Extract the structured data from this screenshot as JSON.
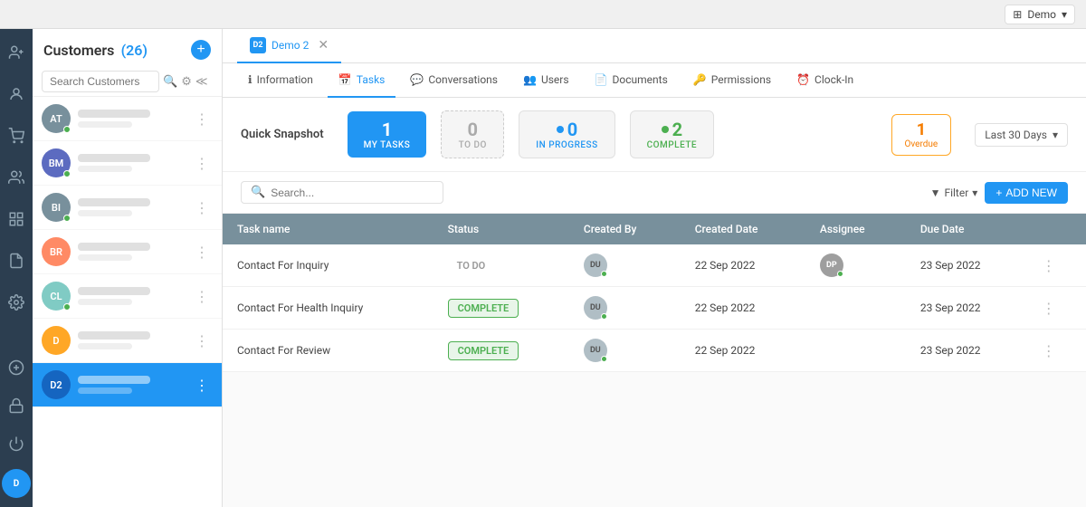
{
  "topbar": {
    "demo_label": "Demo",
    "dropdown_icon": "▾"
  },
  "leftnav": {
    "icons": [
      {
        "name": "add-user-icon",
        "symbol": "👤+",
        "unicode": "⊕"
      },
      {
        "name": "contacts-icon",
        "symbol": "☺"
      },
      {
        "name": "cart-icon",
        "symbol": "🛒"
      },
      {
        "name": "team-icon",
        "symbol": "👥"
      },
      {
        "name": "apps-icon",
        "symbol": "⊞"
      },
      {
        "name": "document-icon",
        "symbol": "📄"
      },
      {
        "name": "settings-icon",
        "symbol": "⚙"
      }
    ],
    "bottom_icons": [
      {
        "name": "add-icon",
        "symbol": "⊕"
      },
      {
        "name": "lock-icon",
        "symbol": "🔒"
      },
      {
        "name": "power-icon",
        "symbol": "⏻"
      }
    ]
  },
  "sidebar": {
    "title": "Customers",
    "count": "(26)",
    "search_placeholder": "Search Customers",
    "customers": [
      {
        "initials": "AT",
        "color": "#78909c",
        "has_dot": true
      },
      {
        "initials": "BM",
        "color": "#5c6bc0",
        "has_dot": true
      },
      {
        "initials": "BI",
        "color": "#78909c",
        "has_dot": true
      },
      {
        "initials": "BR",
        "color": "#ff8a65",
        "has_dot": false
      },
      {
        "initials": "CL",
        "color": "#80cbc4",
        "has_dot": true
      },
      {
        "initials": "D",
        "color": "#ffa726",
        "has_dot": false
      },
      {
        "initials": "D2",
        "color": "#2196f3",
        "has_dot": false,
        "active": true
      }
    ]
  },
  "tabs": [
    {
      "id": "demo2",
      "label": "Demo 2",
      "active": true,
      "closable": true,
      "avatar": "D2",
      "avatar_color": "#2196f3"
    }
  ],
  "sub_nav": {
    "items": [
      {
        "label": "Information",
        "icon": "ℹ",
        "active": false
      },
      {
        "label": "Tasks",
        "icon": "📅",
        "active": true
      },
      {
        "label": "Conversations",
        "icon": "💬",
        "active": false
      },
      {
        "label": "Users",
        "icon": "👥",
        "active": false
      },
      {
        "label": "Documents",
        "icon": "📄",
        "active": false
      },
      {
        "label": "Permissions",
        "icon": "🔑",
        "active": false
      },
      {
        "label": "Clock-In",
        "icon": "⏰",
        "active": false
      }
    ]
  },
  "quick_snapshot": {
    "label": "Quick Snapshot",
    "my_tasks": {
      "count": 1,
      "label": "My Tasks"
    },
    "todo": {
      "count": 0,
      "label": "TO DO"
    },
    "in_progress": {
      "count": 0,
      "label": "IN PROGRESS"
    },
    "complete": {
      "count": 2,
      "label": "COMPLETE"
    },
    "overdue": {
      "count": 1,
      "label": "Overdue"
    },
    "date_filter": "Last 30 Days"
  },
  "tasks": {
    "search_placeholder": "Search...",
    "filter_label": "Filter",
    "add_new_label": "ADD NEW",
    "columns": [
      "Task name",
      "Status",
      "Created By",
      "Created Date",
      "Assignee",
      "Due Date"
    ],
    "rows": [
      {
        "task_name": "Contact For Inquiry",
        "status": "TO DO",
        "status_type": "todo",
        "created_by_initials": "DU",
        "created_by_color": "#b0bec5",
        "created_date": "22 Sep 2022",
        "assignee_initials": "DP",
        "assignee_color": "#9e9e9e",
        "due_date": "23 Sep 2022",
        "assignee_has_dot": true
      },
      {
        "task_name": "Contact For Health Inquiry",
        "status": "COMPLETE",
        "status_type": "complete",
        "created_by_initials": "DU",
        "created_by_color": "#b0bec5",
        "created_date": "22 Sep 2022",
        "assignee_initials": "",
        "assignee_color": "#ccc",
        "due_date": "23 Sep 2022",
        "assignee_has_dot": false
      },
      {
        "task_name": "Contact For Review",
        "status": "COMPLETE",
        "status_type": "complete",
        "created_by_initials": "DU",
        "created_by_color": "#b0bec5",
        "created_date": "22 Sep 2022",
        "assignee_initials": "",
        "assignee_color": "#ccc",
        "due_date": "23 Sep 2022",
        "assignee_has_dot": false
      }
    ]
  }
}
